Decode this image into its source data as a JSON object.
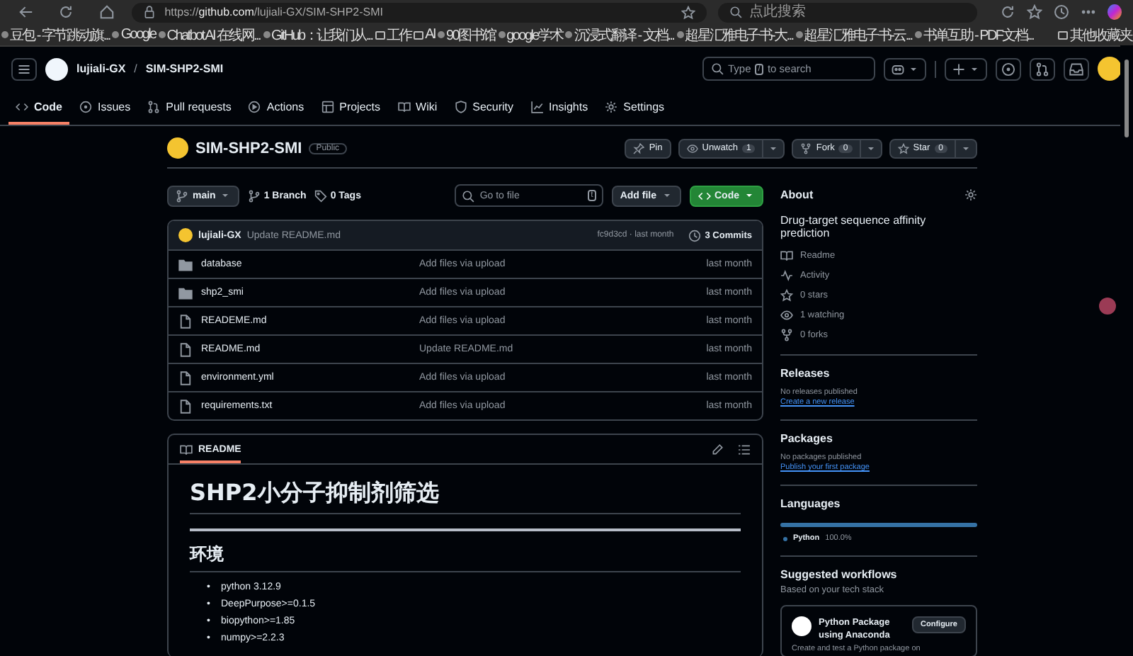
{
  "browser": {
    "url_prefix": "https://",
    "url_host": "github.com",
    "url_path": "/lujiali-GX/SIM-SHP2-SMI",
    "search_placeholder": "点此搜索",
    "bookmarks": [
      {
        "label": "豆包 - 字节跳动旗...",
        "kind": "site"
      },
      {
        "label": "Google",
        "kind": "site"
      },
      {
        "label": "Chatbot AI 在线网...",
        "kind": "site"
      },
      {
        "label": "GitHub：让我们从...",
        "kind": "site"
      },
      {
        "label": "工作",
        "kind": "folder"
      },
      {
        "label": "AI",
        "kind": "folder"
      },
      {
        "label": "90图书馆",
        "kind": "site"
      },
      {
        "label": "google学术",
        "kind": "site"
      },
      {
        "label": "沉浸式翻译 - 文档...",
        "kind": "site"
      },
      {
        "label": "超星汇雅电子书-大...",
        "kind": "site"
      },
      {
        "label": "超星汇雅电子书-云...",
        "kind": "site"
      },
      {
        "label": "书单互助 - PDF文档...",
        "kind": "site"
      }
    ],
    "other_bookmarks": "其他收藏夹"
  },
  "header": {
    "owner": "lujiali-GX",
    "separator": "/",
    "repo": "SIM-SHP2-SMI",
    "search_prefix": "Type",
    "search_key": "/",
    "search_suffix": "to search",
    "tabs": [
      {
        "label": "Code",
        "selected": true
      },
      {
        "label": "Issues",
        "selected": false
      },
      {
        "label": "Pull requests",
        "selected": false
      },
      {
        "label": "Actions",
        "selected": false
      },
      {
        "label": "Projects",
        "selected": false
      },
      {
        "label": "Wiki",
        "selected": false
      },
      {
        "label": "Security",
        "selected": false
      },
      {
        "label": "Insights",
        "selected": false
      },
      {
        "label": "Settings",
        "selected": false
      }
    ]
  },
  "repo": {
    "name": "SIM-SHP2-SMI",
    "visibility": "Public",
    "pin": "Pin",
    "unwatch": "Unwatch",
    "unwatch_count": "1",
    "fork": "Fork",
    "fork_count": "0",
    "star": "Star",
    "star_count": "0"
  },
  "toolbar": {
    "branch": "main",
    "branches": "1 Branch",
    "tags": "0 Tags",
    "goto_placeholder": "Go to file",
    "goto_key": "t",
    "add_file": "Add file",
    "code": "Code"
  },
  "latest_commit": {
    "author": "lujiali-GX",
    "message": "Update README.md",
    "hash_time": "fc9d3cd · last month",
    "commits": "3 Commits"
  },
  "files": [
    {
      "name": "database",
      "kind": "folder",
      "message": "Add files via upload",
      "time": "last month"
    },
    {
      "name": "shp2_smi",
      "kind": "folder",
      "message": "Add files via upload",
      "time": "last month"
    },
    {
      "name": "READEME.md",
      "kind": "file",
      "message": "Add files via upload",
      "time": "last month"
    },
    {
      "name": "README.md",
      "kind": "file",
      "message": "Update README.md",
      "time": "last month"
    },
    {
      "name": "environment.yml",
      "kind": "file",
      "message": "Add files via upload",
      "time": "last month"
    },
    {
      "name": "requirements.txt",
      "kind": "file",
      "message": "Add files via upload",
      "time": "last month"
    }
  ],
  "readme": {
    "tab": "README",
    "title": "SHP2小分子抑制剂筛选",
    "section": "环境",
    "bullet": "•",
    "items": [
      "python 3.12.9",
      "DeepPurpose>=0.1.5",
      "biopython>=1.85",
      "numpy>=2.2.3"
    ]
  },
  "about": {
    "title": "About",
    "description": "Drug-target sequence affinity prediction",
    "stats": [
      "Readme",
      "Activity",
      "0 stars",
      "1 watching",
      "0 forks"
    ]
  },
  "releases": {
    "title": "Releases",
    "note": "No releases published",
    "link": "Create a new release"
  },
  "packages": {
    "title": "Packages",
    "note": "No packages published",
    "link": "Publish your first package"
  },
  "languages": {
    "title": "Languages",
    "items": [
      {
        "name": "Python",
        "percent": "100.0%",
        "color": "#3572a5",
        "level": 1
      }
    ]
  },
  "workflows": {
    "title": "Suggested workflows",
    "subtitle": "Based on your tech stack",
    "card": {
      "name": "Python Package using Anaconda",
      "button": "Configure",
      "description": "Create and test a Python package on"
    }
  }
}
